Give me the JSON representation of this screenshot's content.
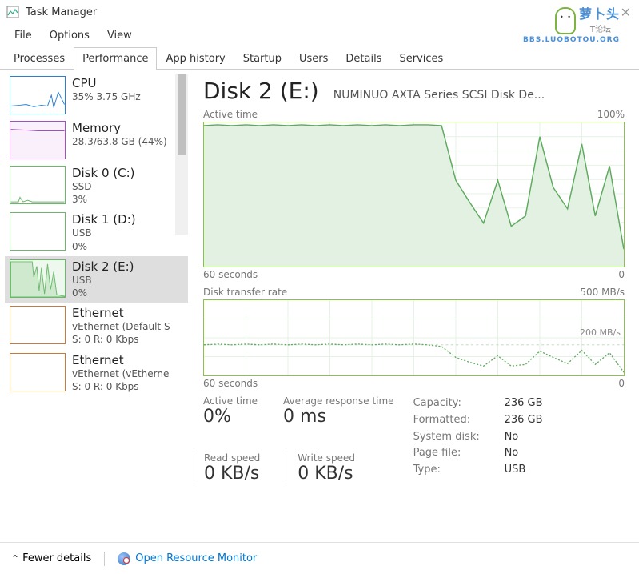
{
  "window": {
    "title": "Task Manager"
  },
  "menu": {
    "file": "File",
    "options": "Options",
    "view": "View"
  },
  "tabs": {
    "processes": "Processes",
    "performance": "Performance",
    "app_history": "App history",
    "startup": "Startup",
    "users": "Users",
    "details": "Details",
    "services": "Services"
  },
  "sidebar": {
    "items": [
      {
        "name": "CPU",
        "sub1": "35%  3.75 GHz",
        "sub2": "",
        "color": "#2a7fd4"
      },
      {
        "name": "Memory",
        "sub1": "28.3/63.8 GB (44%)",
        "sub2": "",
        "color": "#a050c0"
      },
      {
        "name": "Disk 0 (C:)",
        "sub1": "SSD",
        "sub2": "3%",
        "color": "#6bb86b"
      },
      {
        "name": "Disk 1 (D:)",
        "sub1": "USB",
        "sub2": "0%",
        "color": "#6bb86b"
      },
      {
        "name": "Disk 2 (E:)",
        "sub1": "USB",
        "sub2": "0%",
        "color": "#6bb86b"
      },
      {
        "name": "Ethernet",
        "sub1": "vEthernet (Default S",
        "sub2": "S: 0  R:  0 Kbps",
        "color": "#c77a3a"
      },
      {
        "name": "Ethernet",
        "sub1": "vEthernet (vEtherne",
        "sub2": "S: 0  R:  0 Kbps",
        "color": "#c77a3a"
      }
    ]
  },
  "main": {
    "title": "Disk 2 (E:)",
    "subtitle": "NUMINUO AXTA Series SCSI Disk De...",
    "active_time_label": "Active time",
    "active_time_max": "100%",
    "xfer_label": "Disk transfer rate",
    "xfer_max": "500 MB/s",
    "xfer_mid": "200 MB/s",
    "x_left": "60 seconds",
    "x_right": "0"
  },
  "stats": {
    "active_time": {
      "label": "Active time",
      "value": "0%"
    },
    "avg_response": {
      "label": "Average response time",
      "value": "0 ms"
    },
    "read_speed": {
      "label": "Read speed",
      "value": "0 KB/s"
    },
    "write_speed": {
      "label": "Write speed",
      "value": "0 KB/s"
    }
  },
  "details": {
    "capacity": {
      "key": "Capacity:",
      "val": "236 GB"
    },
    "formatted": {
      "key": "Formatted:",
      "val": "236 GB"
    },
    "system_disk": {
      "key": "System disk:",
      "val": "No"
    },
    "page_file": {
      "key": "Page file:",
      "val": "No"
    },
    "type": {
      "key": "Type:",
      "val": "USB"
    }
  },
  "footer": {
    "fewer_details": "Fewer details",
    "open_rm": "Open Resource Monitor"
  },
  "watermark": {
    "cn": "萝卜头",
    "sub": "IT论坛",
    "en": "BBS.LUOBOTOU.ORG"
  },
  "chart_data": [
    {
      "type": "area",
      "title": "Active time",
      "xlabel": "60 seconds → 0",
      "ylabel": "%",
      "ylim": [
        0,
        100
      ],
      "x_seconds_ago": [
        60,
        58,
        56,
        54,
        52,
        50,
        48,
        46,
        44,
        42,
        40,
        38,
        36,
        34,
        32,
        30,
        28,
        26,
        24,
        22,
        20,
        18,
        16,
        14,
        12,
        10,
        8,
        6,
        4,
        2,
        0
      ],
      "values": [
        98,
        99,
        98,
        99,
        98,
        99,
        98,
        99,
        98,
        99,
        98,
        99,
        98,
        99,
        98,
        99,
        99,
        98,
        60,
        45,
        30,
        60,
        28,
        35,
        90,
        55,
        40,
        85,
        35,
        70,
        12
      ]
    },
    {
      "type": "line",
      "title": "Disk transfer rate",
      "xlabel": "60 seconds → 0",
      "ylabel": "MB/s",
      "ylim": [
        0,
        500
      ],
      "reference_lines": [
        200
      ],
      "x_seconds_ago": [
        60,
        58,
        56,
        54,
        52,
        50,
        48,
        46,
        44,
        42,
        40,
        38,
        36,
        34,
        32,
        30,
        28,
        26,
        24,
        22,
        20,
        18,
        16,
        14,
        12,
        10,
        8,
        6,
        4,
        2,
        0
      ],
      "values": [
        205,
        208,
        205,
        206,
        205,
        207,
        205,
        206,
        205,
        207,
        205,
        206,
        205,
        206,
        205,
        206,
        205,
        195,
        120,
        90,
        60,
        130,
        60,
        70,
        160,
        120,
        75,
        165,
        70,
        150,
        20
      ]
    }
  ]
}
